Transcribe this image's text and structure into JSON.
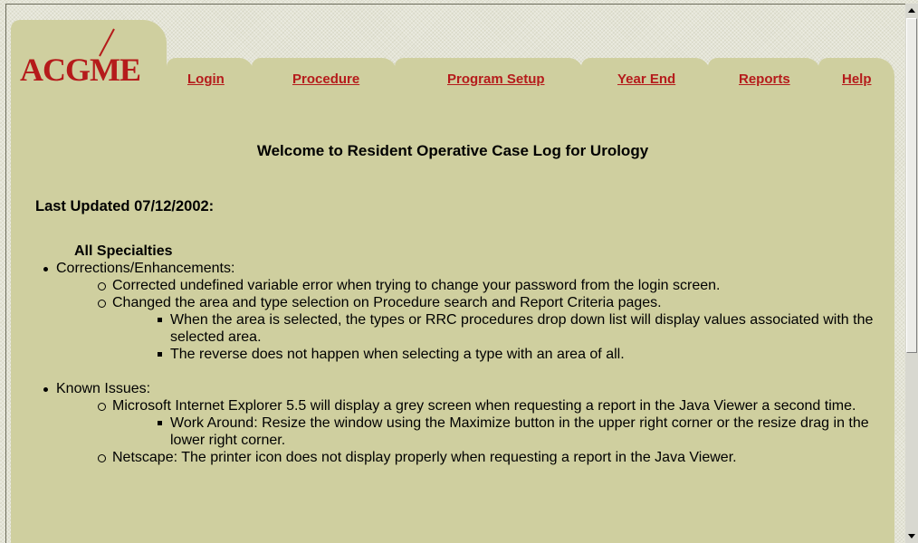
{
  "logo": {
    "text": "ACGME"
  },
  "nav": {
    "items": [
      {
        "label": "Login"
      },
      {
        "label": "Procedure"
      },
      {
        "label": "Program Setup"
      },
      {
        "label": "Year End"
      },
      {
        "label": "Reports"
      },
      {
        "label": "Help"
      }
    ]
  },
  "welcome": "Welcome to Resident Operative Case Log for Urology",
  "last_updated": "Last Updated 07/12/2002:",
  "section_heading": "All Specialties",
  "sections": [
    {
      "label": "Corrections/Enhancements:",
      "items": [
        {
          "text": "Corrected undefined variable error when trying to change your password from the login screen."
        },
        {
          "text": "Changed the area and type selection on Procedure search and Report Criteria pages.",
          "sub": [
            "When the area is selected, the types or RRC procedures drop down list will display values associated with the selected area.",
            "The reverse does not happen when selecting a type with an area of all."
          ]
        }
      ]
    },
    {
      "label": "Known Issues:",
      "items": [
        {
          "text": "Microsoft Internet Explorer 5.5 will display a grey screen when requesting a report in the Java Viewer a second time.",
          "sub": [
            "Work Around: Resize the window using the Maximize button in the upper right corner or the resize drag in the lower right corner."
          ]
        },
        {
          "text": "Netscape: The printer icon does not display properly when requesting a report in the Java Viewer."
        }
      ]
    }
  ],
  "colors": {
    "panel": "#cfcf9f",
    "link": "#b51b1b",
    "logo": "#b51b1b"
  }
}
